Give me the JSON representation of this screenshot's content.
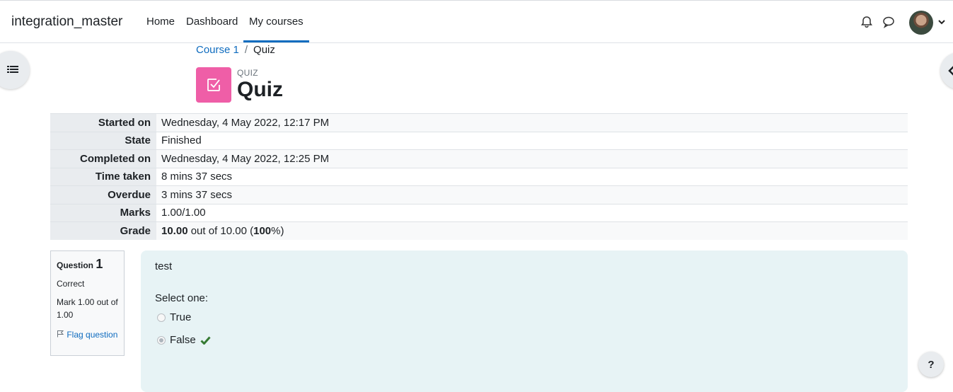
{
  "navbar": {
    "brand": "integration_master",
    "links": [
      "Home",
      "Dashboard",
      "My courses"
    ],
    "active_link": "My courses"
  },
  "breadcrumb": {
    "course": "Course 1",
    "separator": "/",
    "current": "Quiz"
  },
  "header": {
    "module_type": "QUIZ",
    "title": "Quiz",
    "icon": "quiz-icon",
    "icon_bg": "#ef5ea7"
  },
  "summary": {
    "rows": [
      {
        "label": "Started on",
        "value": "Wednesday, 4 May 2022, 12:17 PM"
      },
      {
        "label": "State",
        "value": "Finished"
      },
      {
        "label": "Completed on",
        "value": "Wednesday, 4 May 2022, 12:25 PM"
      },
      {
        "label": "Time taken",
        "value": "8 mins 37 secs"
      },
      {
        "label": "Overdue",
        "value": "3 mins 37 secs"
      },
      {
        "label": "Marks",
        "value": "1.00/1.00"
      }
    ],
    "grade": {
      "label": "Grade",
      "score": "10.00",
      "out_of": " out of 10.00 (",
      "percent": "100",
      "suffix": "%)"
    }
  },
  "question": {
    "label": "Question",
    "number": "1",
    "state": "Correct",
    "mark": "Mark 1.00 out of 1.00",
    "flag": "Flag question",
    "text": "test",
    "prompt": "Select one:",
    "options": [
      {
        "label": "True",
        "selected": false
      },
      {
        "label": "False",
        "selected": true,
        "correct": true
      }
    ]
  },
  "help": {
    "label": "?"
  },
  "colors": {
    "accent": "#0f6cbf",
    "correct": "#357a32",
    "question_bg": "#e7f3f5"
  }
}
